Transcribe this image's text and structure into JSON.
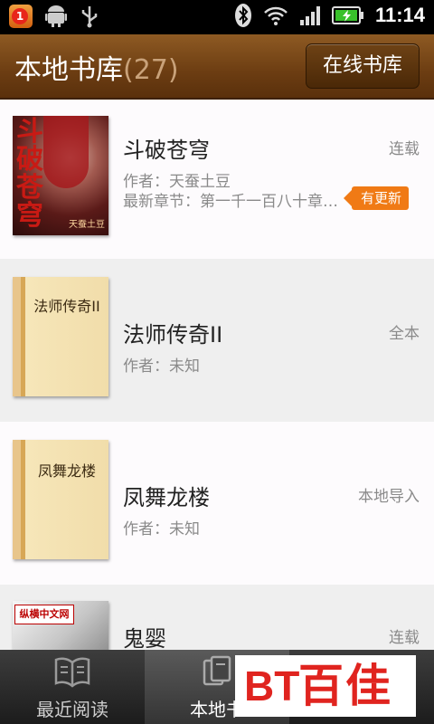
{
  "status_bar": {
    "notification_count": "1",
    "time": "11:14"
  },
  "header": {
    "title": "本地书库",
    "count": "(27)",
    "online_button": "在线书库"
  },
  "books": [
    {
      "title": "斗破苍穹",
      "status": "连载",
      "author": "作者：天蚕土豆",
      "latest": "最新章节：第一千一百八十章…",
      "badge": "有更新",
      "cover_type": "art",
      "cover_text": "斗破苍穹",
      "cover_stamp": "天蚕土豆"
    },
    {
      "title": "法师传奇II",
      "status": "全本",
      "author": "作者：未知",
      "cover_type": "book",
      "cover_text": "法师传奇II"
    },
    {
      "title": "凤舞龙楼",
      "status": "本地导入",
      "author": "作者：未知",
      "cover_type": "book",
      "cover_text": "凤舞龙楼"
    },
    {
      "title": "鬼婴",
      "status": "连载",
      "cover_type": "sketch",
      "cover_logo": "纵横中文网"
    }
  ],
  "tabs": [
    {
      "label": "最近阅读",
      "icon": "open-book-icon"
    },
    {
      "label": "本地书",
      "icon": "books-icon"
    }
  ],
  "watermark": {
    "logo": "BT",
    "text": "百佳"
  }
}
